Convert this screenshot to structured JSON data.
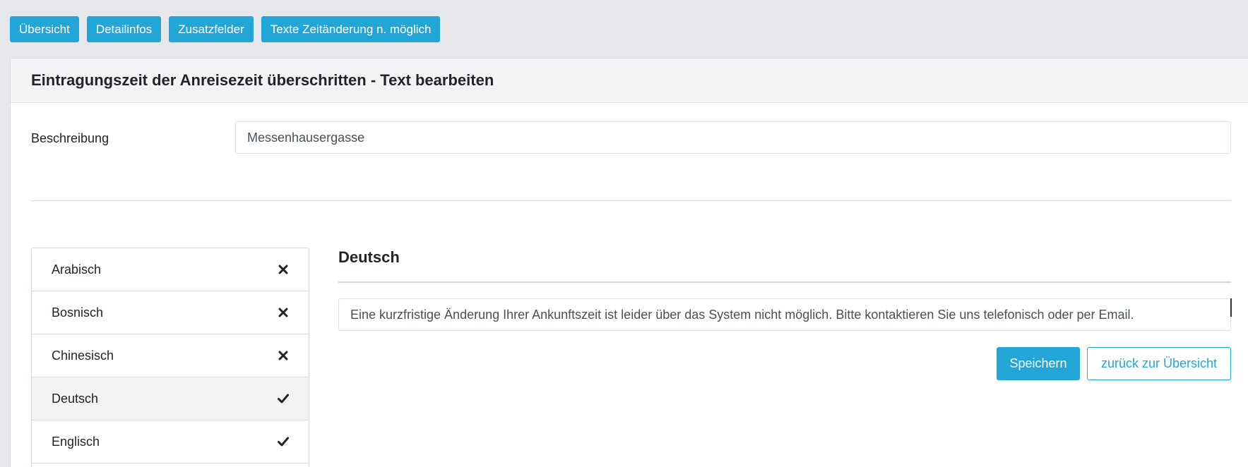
{
  "nav": {
    "buttons": [
      "Übersicht",
      "Detailinfos",
      "Zusatzfelder",
      "Texte Zeitänderung n. möglich"
    ]
  },
  "card": {
    "title": "Eintragungszeit der Anreisezeit überschritten - Text bearbeiten"
  },
  "form": {
    "description_label": "Beschreibung",
    "description_value": "Messenhausergasse"
  },
  "languages": [
    {
      "label": "Arabisch",
      "status": "missing",
      "icon": "x-icon"
    },
    {
      "label": "Bosnisch",
      "status": "missing",
      "icon": "x-icon"
    },
    {
      "label": "Chinesisch",
      "status": "missing",
      "icon": "x-icon"
    },
    {
      "label": "Deutsch",
      "status": "done",
      "icon": "check-icon",
      "active": true
    },
    {
      "label": "Englisch",
      "status": "done",
      "icon": "check-icon"
    }
  ],
  "editor": {
    "language_title": "Deutsch",
    "text_value": "Eine kurzfristige Änderung Ihrer Ankunftszeit ist leider über das System nicht möglich. Bitte kontaktieren Sie uns telefonisch oder per Email.",
    "save_label": "Speichern",
    "back_label": "zurück zur Übersicht"
  },
  "colors": {
    "accent": "#22a6d8",
    "background": "#e5e7eb",
    "header_bg": "#f1f3f5"
  }
}
